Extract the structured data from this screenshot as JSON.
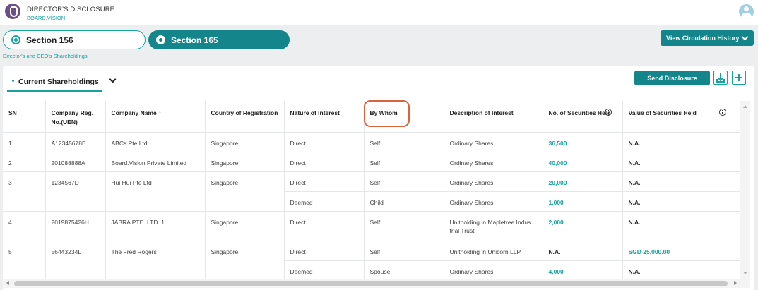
{
  "header": {
    "app_title": "DIRECTOR'S DISCLOSURE",
    "app_subtitle": "BOARD.VISION",
    "logo_icon": "board-vision-logo",
    "user_icon": "user-avatar-icon"
  },
  "sections": {
    "section_156_label": "Section 156",
    "section_165_label": "Section 165",
    "active": "Section 165",
    "caption": "Director's and CEO's Shareholdings"
  },
  "toolbar": {
    "view_history_label": "View Circulation History",
    "current_tab_label": "Current Shareholdings",
    "send_disclosure_label": "Send Disclosure",
    "download_icon": "download-icon",
    "add_icon": "plus-icon"
  },
  "table": {
    "headers": {
      "sn": "SN",
      "reg_no": "Company Reg. No.(UEN)",
      "company_name": "Company Name ↑",
      "country": "Country of Registration",
      "nature": "Nature of Interest",
      "by_whom": "By Whom",
      "description": "Description of Interest",
      "securities": "No. of Securities Held",
      "value": "Value of Securities Held"
    },
    "rows": [
      {
        "sn": "1",
        "reg": "A12345678E",
        "company": "ABCs Pte Ltd",
        "country": "Singapore",
        "interests": [
          {
            "nature": "Direct",
            "by_whom": "Self",
            "description": "Ordinary Shares",
            "securities": "36,500",
            "value": "N.A."
          }
        ]
      },
      {
        "sn": "2",
        "reg": "201088888A",
        "company": "Board.Vision Private Limited",
        "country": "Singapore",
        "interests": [
          {
            "nature": "Direct",
            "by_whom": "Self",
            "description": "Ordinary Shares",
            "securities": "40,000",
            "value": "N.A."
          }
        ]
      },
      {
        "sn": "3",
        "reg": "1234567D",
        "company": "Hui Hui Pte Ltd",
        "country": "Singapore",
        "interests": [
          {
            "nature": "Direct",
            "by_whom": "Self",
            "description": "Ordinary Shares",
            "securities": "20,000",
            "value": "N.A."
          },
          {
            "nature": "Deemed",
            "by_whom": "Child",
            "description": "Ordinary Shares",
            "securities": "1,000",
            "value": "N.A."
          }
        ]
      },
      {
        "sn": "4",
        "reg": "2019875426H",
        "company": "JABRA PTE. LTD. 1",
        "country": "Singapore",
        "interests": [
          {
            "nature": "Direct",
            "by_whom": "Self",
            "description": "Unitholding in Mapletree Indus trial Trust",
            "securities": "2,000",
            "value": "N.A."
          }
        ]
      },
      {
        "sn": "5",
        "reg": "56443234L",
        "company": "The Fred Rogers",
        "country": "Singapore",
        "interests": [
          {
            "nature": "Direct",
            "by_whom": "Self",
            "description": "Unitholding in Unicorn LLP",
            "securities": "N.A.",
            "value": "SGD  25,000.00"
          },
          {
            "nature": "Deemed",
            "by_whom": "Spouse",
            "description": "Ordinary Shares",
            "securities": "4,000",
            "value": "N.A."
          }
        ]
      }
    ]
  },
  "colors": {
    "accent": "#14858a",
    "accent_light": "#16a3a0",
    "highlight": "#d9653f"
  }
}
